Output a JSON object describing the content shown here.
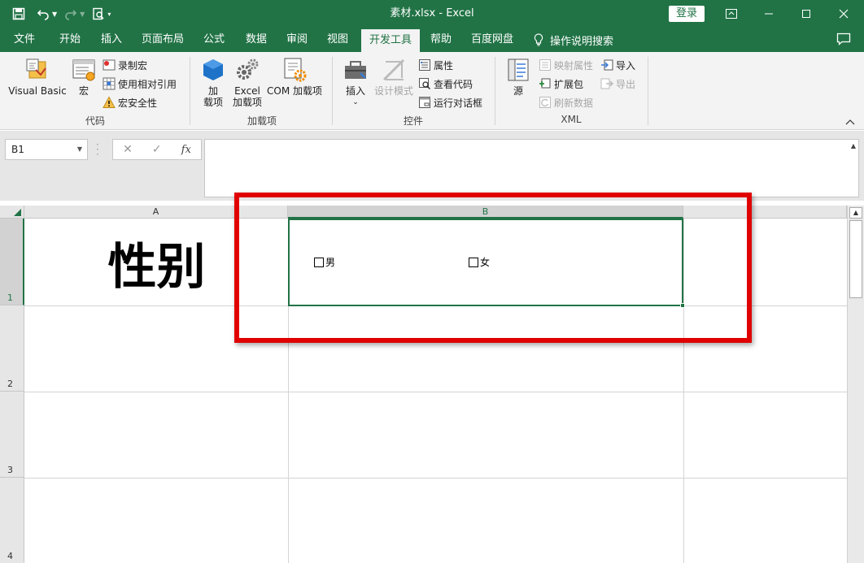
{
  "window": {
    "doc_title": "素材.xlsx  -  Excel",
    "login_label": "登录"
  },
  "tabs": [
    {
      "label": "文件"
    },
    {
      "label": "开始"
    },
    {
      "label": "插入"
    },
    {
      "label": "页面布局"
    },
    {
      "label": "公式"
    },
    {
      "label": "数据"
    },
    {
      "label": "审阅"
    },
    {
      "label": "视图"
    },
    {
      "label": "开发工具",
      "active": true
    },
    {
      "label": "帮助"
    },
    {
      "label": "百度网盘"
    }
  ],
  "tell_me": "操作说明搜索",
  "ribbon": {
    "code": {
      "group_label": "代码",
      "visual_basic": "Visual Basic",
      "macro": "宏",
      "record_macro": "录制宏",
      "relative_ref": "使用相对引用",
      "macro_security": "宏安全性"
    },
    "addins": {
      "group_label": "加载项",
      "addins_line1": "加",
      "addins_line2": "载项",
      "excel_addins_line1": "Excel",
      "excel_addins_line2": "加载项",
      "com_addins": "COM 加载项"
    },
    "controls": {
      "group_label": "控件",
      "insert": "插入",
      "design_mode": "设计模式",
      "properties": "属性",
      "view_code": "查看代码",
      "run_dialog": "运行对话框"
    },
    "xml": {
      "group_label": "XML",
      "source": "源",
      "map_properties": "映射属性",
      "expansion_packs": "扩展包",
      "refresh_data": "刷新数据",
      "import": "导入",
      "export": "导出"
    }
  },
  "formula_bar": {
    "name_box": "B1",
    "formula": ""
  },
  "sheet": {
    "columns": [
      "A",
      "B"
    ],
    "rows": [
      "1",
      "2",
      "3",
      "4"
    ],
    "a1_value": "性别",
    "checkboxes": [
      {
        "label": "男",
        "checked": false
      },
      {
        "label": "女",
        "checked": false
      }
    ]
  },
  "colors": {
    "excel_green": "#217346",
    "highlight_red": "#e00000"
  }
}
